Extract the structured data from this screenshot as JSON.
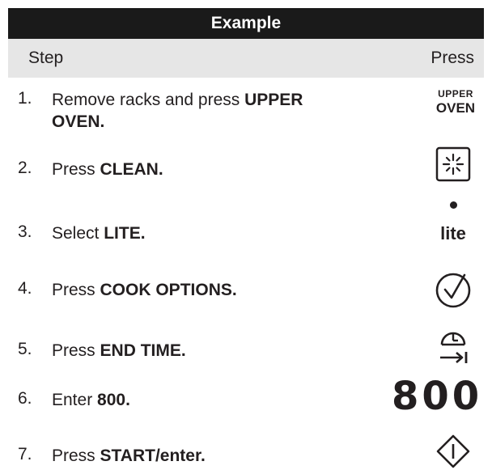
{
  "title": "Example",
  "header": {
    "step": "Step",
    "press": "Press"
  },
  "steps": [
    {
      "number": "1.",
      "text_plain": "Remove racks and press ",
      "text_bold": "UPPER",
      "text_bold_line2": "OVEN.",
      "icon": "upper-oven-button"
    },
    {
      "number": "2.",
      "text_plain": "Press ",
      "text_bold": "CLEAN.",
      "icon": "clean-icon"
    },
    {
      "number": "3.",
      "text_plain": "Select ",
      "text_bold": "LITE.",
      "icon": "lite-button"
    },
    {
      "number": "4.",
      "text_plain": "Press ",
      "text_bold": "COOK OPTIONS.",
      "icon": "checkmark-circle-icon"
    },
    {
      "number": "5.",
      "text_plain": "Press ",
      "text_bold": "END TIME.",
      "icon": "end-time-clock-icon"
    },
    {
      "number": "6.",
      "text_plain": "Enter ",
      "text_bold": "800.",
      "icon": "digits"
    },
    {
      "number": "7.",
      "text_plain": "Press ",
      "text_bold": "START/enter.",
      "icon": "start-diamond-icon"
    }
  ],
  "button_labels": {
    "upper_line1": "UPPER",
    "upper_line2": "OVEN",
    "lite": "lite",
    "digits": "800"
  }
}
